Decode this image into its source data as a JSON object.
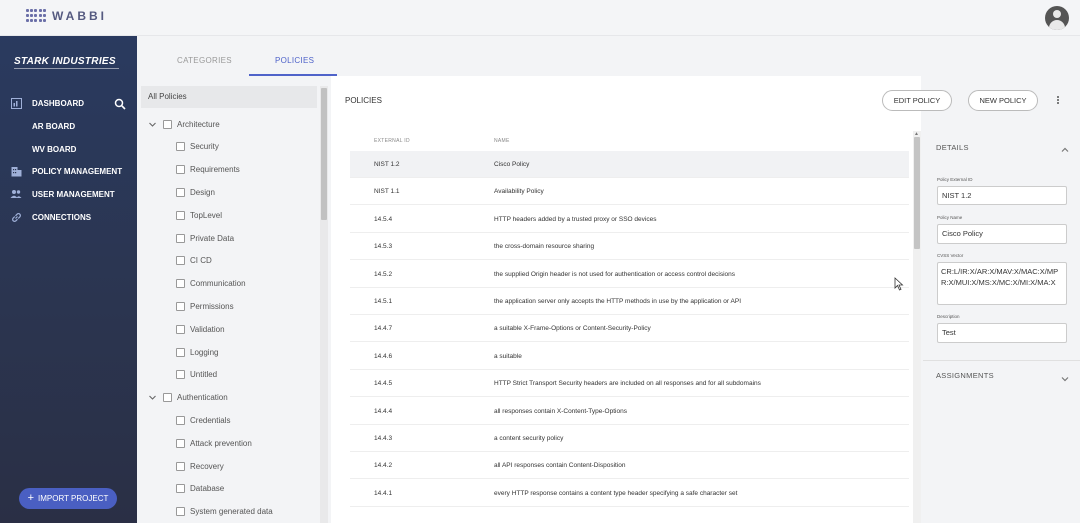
{
  "app": {
    "logo_text": "WABBI",
    "brand": "STARK INDUSTRIES"
  },
  "sidebar": {
    "items": [
      {
        "label": "DASHBOARD",
        "icon": "dashboard-icon"
      },
      {
        "label": "AR BOARD"
      },
      {
        "label": "WV BOARD"
      },
      {
        "label": "POLICY MANAGEMENT",
        "icon": "building-icon"
      },
      {
        "label": "USER MANAGEMENT",
        "icon": "users-icon"
      },
      {
        "label": "CONNECTIONS",
        "icon": "link-icon"
      }
    ],
    "import_label": "IMPORT PROJECT"
  },
  "tabs": [
    {
      "label": "CATEGORIES"
    },
    {
      "label": "POLICIES",
      "active": true
    }
  ],
  "tree": {
    "header": "All Policies",
    "items": [
      {
        "label": "Architecture",
        "level": 0,
        "expanded": true
      },
      {
        "label": "Security",
        "level": 1
      },
      {
        "label": "Requirements",
        "level": 1
      },
      {
        "label": "Design",
        "level": 1
      },
      {
        "label": "TopLevel",
        "level": 1
      },
      {
        "label": "Private Data",
        "level": 1
      },
      {
        "label": "CI CD",
        "level": 1
      },
      {
        "label": "Communication",
        "level": 1
      },
      {
        "label": "Permissions",
        "level": 1
      },
      {
        "label": "Validation",
        "level": 1
      },
      {
        "label": "Logging",
        "level": 1
      },
      {
        "label": "Untitled",
        "level": 1
      },
      {
        "label": "Authentication",
        "level": 0,
        "expanded": true
      },
      {
        "label": "Credentials",
        "level": 1
      },
      {
        "label": "Attack prevention",
        "level": 1
      },
      {
        "label": "Recovery",
        "level": 1
      },
      {
        "label": "Database",
        "level": 1
      },
      {
        "label": "System generated data",
        "level": 1
      }
    ]
  },
  "policies": {
    "title": "POLICIES",
    "edit_label": "EDIT POLICY",
    "new_label": "NEW POLICY",
    "columns": {
      "id": "EXTERNAL ID",
      "name": "NAME"
    },
    "rows": [
      {
        "id": "NIST 1.2",
        "name": "Cisco Policy",
        "selected": true
      },
      {
        "id": "NIST 1.1",
        "name": "Availability Policy"
      },
      {
        "id": "14.5.4",
        "name": "HTTP headers added by a trusted proxy or SSO devices"
      },
      {
        "id": "14.5.3",
        "name": "the cross-domain resource sharing"
      },
      {
        "id": "14.5.2",
        "name": "the supplied Origin header is not used for authentication or access control decisions"
      },
      {
        "id": "14.5.1",
        "name": "the application server only accepts the HTTP methods in use by the application or API"
      },
      {
        "id": "14.4.7",
        "name": "a suitable X-Frame-Options or Content-Security-Policy"
      },
      {
        "id": "14.4.6",
        "name": "a suitable"
      },
      {
        "id": "14.4.5",
        "name": "HTTP Strict Transport Security headers are included on all responses and for all subdomains"
      },
      {
        "id": "14.4.4",
        "name": "all responses contain X-Content-Type-Options"
      },
      {
        "id": "14.4.3",
        "name": "a content security policy"
      },
      {
        "id": "14.4.2",
        "name": "all API responses contain Content-Disposition"
      },
      {
        "id": "14.4.1",
        "name": "every HTTP response contains a content type header specifying a safe character set"
      }
    ]
  },
  "details": {
    "title": "DETAILS",
    "external_id_label": "Policy External ID",
    "external_id": "NIST 1.2",
    "name_label": "Policy Name",
    "name": "Cisco Policy",
    "cvss_label": "CVSS Vector",
    "cvss": "CR:L/IR:X/AR:X/MAV:X/MAC:X/MPR:X/MUI:X/MS:X/MC:X/MI:X/MA:X",
    "description_label": "Description",
    "description": "Test",
    "assignments_title": "ASSIGNMENTS"
  },
  "colors": {
    "accent": "#4f63c9",
    "sidebar": "#2b3550",
    "import_button": "#4a5fc2"
  }
}
